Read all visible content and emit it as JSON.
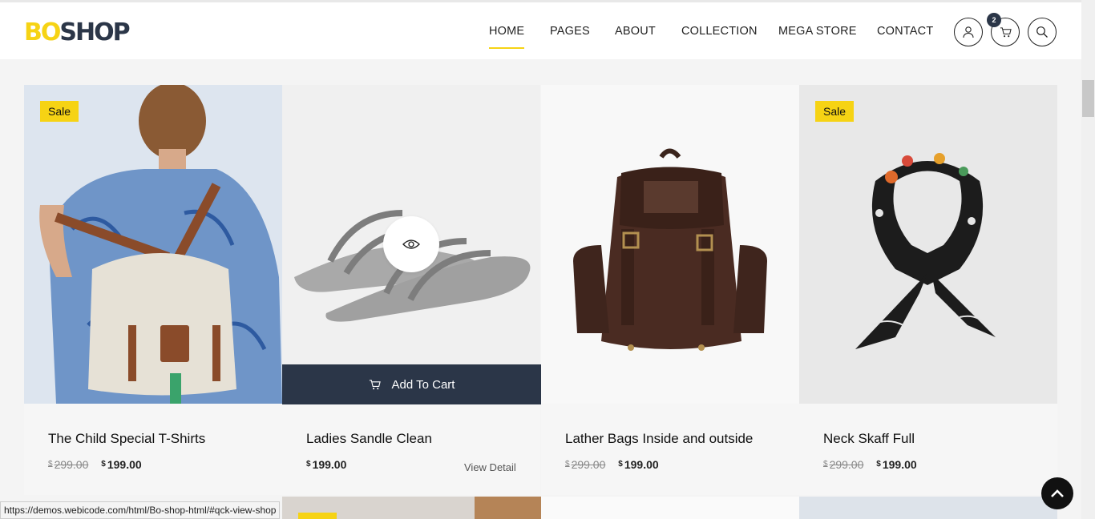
{
  "header": {
    "logo_part1": "BO",
    "logo_part2": "SHOP",
    "nav": [
      {
        "label": "HOME",
        "active": true
      },
      {
        "label": "PAGES"
      },
      {
        "label": "ABOUT"
      },
      {
        "label": "COLLECTION"
      },
      {
        "label": "MEGA STORE"
      },
      {
        "label": "CONTACT"
      }
    ],
    "cart_count": "2",
    "icons": [
      "user-icon",
      "cart-icon",
      "search-icon"
    ]
  },
  "products": [
    {
      "title": "The Child Special T-Shirts",
      "sale": "Sale",
      "currency": "$",
      "old_price": "299.00",
      "price": "199.00"
    },
    {
      "title": "Ladies Sandle Clean",
      "currency": "$",
      "price": "199.00",
      "add_to_cart": "Add To Cart",
      "view_detail": "View Detail"
    },
    {
      "title": "Lather Bags Inside and outside",
      "currency": "$",
      "old_price": "299.00",
      "price": "199.00"
    },
    {
      "title": "Neck Skaff Full",
      "sale": "Sale",
      "currency": "$",
      "old_price": "299.00",
      "price": "199.00"
    }
  ],
  "status_bar": {
    "url": "https://demos.webicode.com/html/Bo-shop-html/#qck-view-shop"
  },
  "colors": {
    "accent": "#f6d314",
    "dark": "#2b3648"
  }
}
